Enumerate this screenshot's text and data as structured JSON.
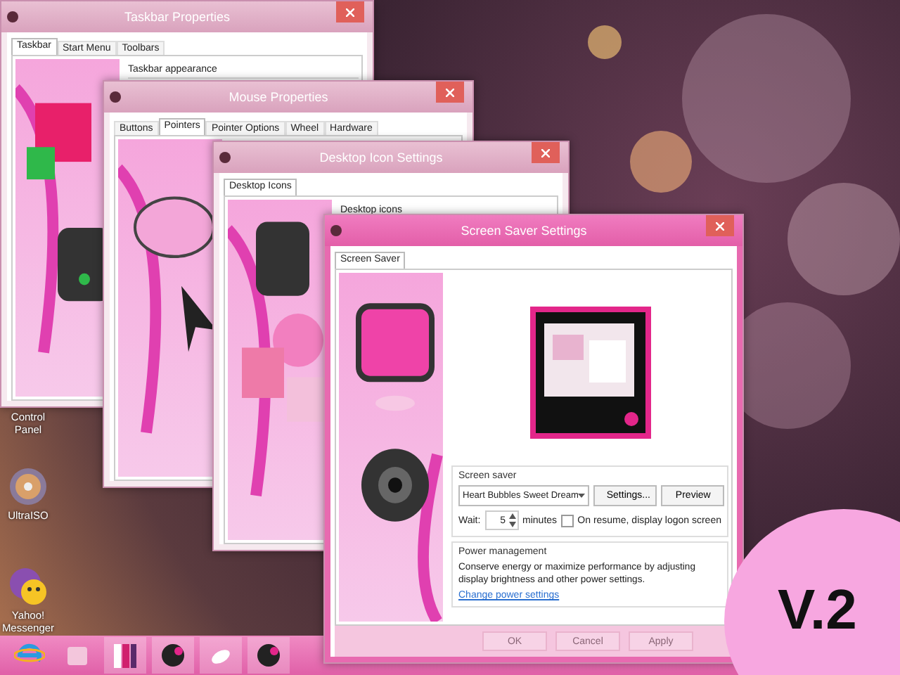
{
  "desktop_icons": [
    {
      "label": "Control Panel"
    },
    {
      "label": "UltraISO"
    },
    {
      "label": "Yahoo! Messenger"
    }
  ],
  "windows": [
    {
      "kind": "tabbed",
      "title": "Taskbar Properties",
      "active": false,
      "tabs": [
        {
          "label": "Taskbar",
          "selected": true
        },
        {
          "label": "Start Menu",
          "selected": false
        },
        {
          "label": "Toolbars",
          "selected": false
        }
      ],
      "group": "Taskbar appearance"
    },
    {
      "kind": "tabbed",
      "title": "Mouse Properties",
      "active": false,
      "tabs": [
        {
          "label": "Buttons",
          "selected": false
        },
        {
          "label": "Pointers",
          "selected": true
        },
        {
          "label": "Pointer Options",
          "selected": false
        },
        {
          "label": "Wheel",
          "selected": false
        },
        {
          "label": "Hardware",
          "selected": false
        }
      ]
    },
    {
      "kind": "tabbed",
      "title": "Desktop Icon Settings",
      "active": false,
      "tabs": [
        {
          "label": "Desktop Icons",
          "selected": true
        }
      ],
      "group": "Desktop icons"
    },
    {
      "kind": "screensaver",
      "title": "Screen Saver Settings",
      "active": true,
      "tabs": [
        {
          "label": "Screen Saver",
          "selected": true
        }
      ],
      "saver_group": "Screen saver",
      "saver_value": "Heart Bubbles Sweet Dream",
      "saver_buttons": [
        "Settings...",
        "Preview"
      ],
      "wait_label": "Wait:",
      "wait_value": "5",
      "wait_unit": "minutes",
      "resume": {
        "label": "On resume, display logon screen",
        "checked": false
      },
      "power_group": "Power management",
      "power_text": "Conserve energy or maximize performance by adjusting display brightness and other power settings.",
      "power_link": "Change power settings",
      "dialog_buttons": [
        "OK",
        "Cancel",
        "Apply"
      ]
    }
  ],
  "badge": "V.2"
}
